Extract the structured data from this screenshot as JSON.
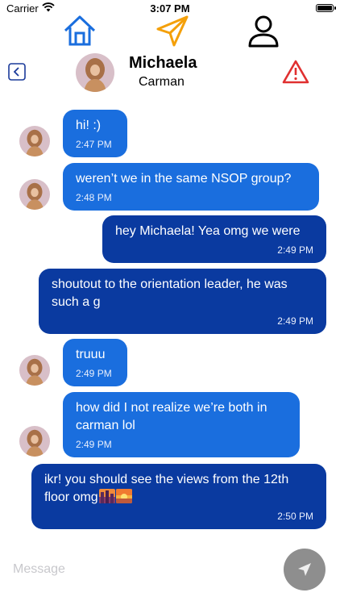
{
  "status_bar": {
    "carrier": "Carrier",
    "time": "3:07 PM"
  },
  "tabs": [
    {
      "icon": "home-icon",
      "active": false
    },
    {
      "icon": "send-arrow-icon",
      "active": true
    },
    {
      "icon": "person-icon",
      "active": false
    }
  ],
  "header": {
    "first_name": "Michaela",
    "last_name": "Carman"
  },
  "colors": {
    "incoming_bubble": "#1a6ede",
    "outgoing_bubble": "#0a3aa0",
    "active_tab": "#f4a00a",
    "nav_blue": "#1a6ede",
    "warning": "#e03030"
  },
  "messages": [
    {
      "direction": "incoming",
      "text": "hi! :)",
      "time": "2:47 PM"
    },
    {
      "direction": "incoming",
      "text": "weren’t we in the same NSOP group?",
      "time": "2:48 PM"
    },
    {
      "direction": "outgoing",
      "text": "hey Michaela! Yea omg we were",
      "time": "2:49 PM"
    },
    {
      "direction": "outgoing",
      "text": "shoutout to the orientation leader, he was such a g",
      "time": "2:49 PM"
    },
    {
      "direction": "incoming",
      "text": "truuu",
      "time": "2:49 PM"
    },
    {
      "direction": "incoming",
      "text": "how did I not realize we’re both in carman lol",
      "time": "2:49 PM"
    },
    {
      "direction": "outgoing",
      "text": "ikr! you should see the views from the 12th floor omg",
      "time": "2:50 PM",
      "emojis": [
        "city-sunset-emoji",
        "sunset-emoji"
      ]
    }
  ],
  "composer": {
    "placeholder": "Message"
  }
}
